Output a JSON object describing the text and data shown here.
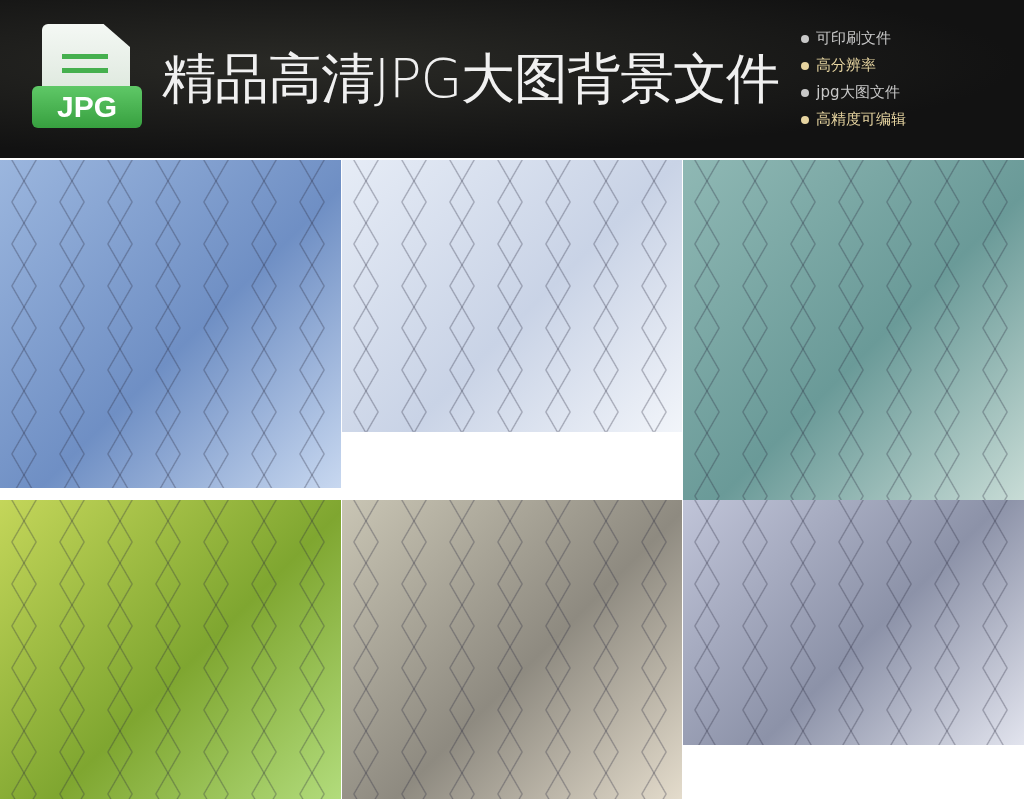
{
  "header": {
    "icon_label": "JPG",
    "title": "精品高清JPG大图背景文件",
    "features": [
      {
        "text": "可印刷文件",
        "color": "#c8c8c8"
      },
      {
        "text": "高分辨率",
        "color": "#e6d4a0"
      },
      {
        "text": "jpg大图文件",
        "color": "#c8c8c8"
      },
      {
        "text": "高精度可编辑",
        "color": "#e6d4a0"
      }
    ]
  }
}
